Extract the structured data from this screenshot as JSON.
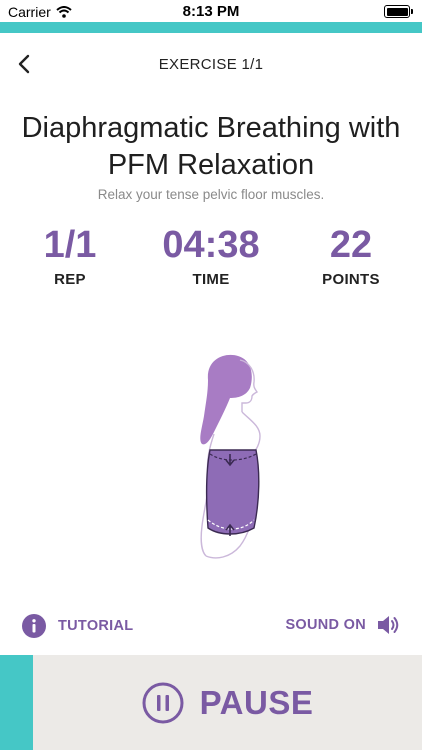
{
  "status_bar": {
    "carrier": "Carrier",
    "time": "8:13 PM"
  },
  "progress": {
    "value": 1.0,
    "color": "#45c7c6"
  },
  "nav": {
    "title": "EXERCISE 1/1"
  },
  "exercise": {
    "title_line1": "Diaphragmatic Breathing with",
    "title_line2": "PFM Relaxation",
    "subtitle": "Relax your tense pelvic floor muscles."
  },
  "stats": {
    "rep": {
      "value": "1/1",
      "label": "REP"
    },
    "time": {
      "value": "04:38",
      "label": "TIME"
    },
    "points": {
      "value": "22",
      "label": "POINTS"
    }
  },
  "controls": {
    "tutorial_label": "TUTORIAL",
    "sound_label": "SOUND ON",
    "pause_label": "PAUSE"
  },
  "icons": {
    "back": "chevron-left-icon",
    "info": "info-icon",
    "sound": "speaker-icon",
    "pause": "pause-icon",
    "wifi": "wifi-icon",
    "battery": "battery-icon"
  },
  "colors": {
    "accent": "#7a5aa3",
    "teal": "#45c7c6",
    "bar_bg": "#eceae7"
  }
}
